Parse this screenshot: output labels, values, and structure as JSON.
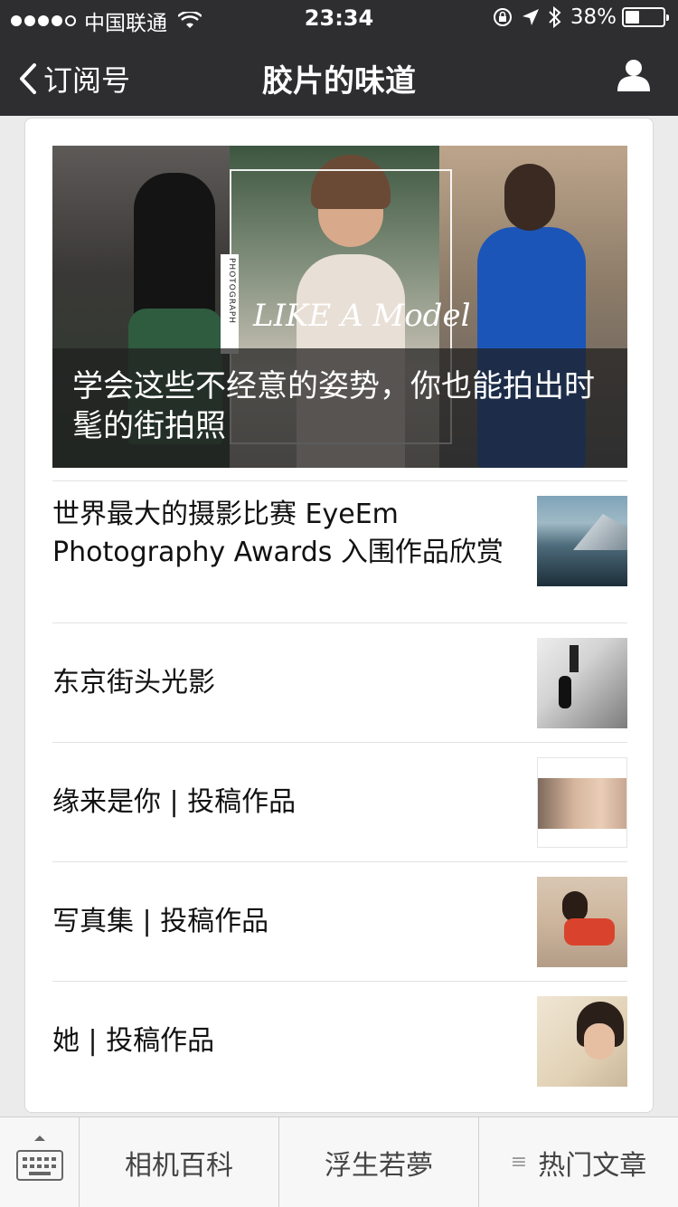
{
  "status_bar": {
    "carrier": "中国联通",
    "time": "23:34",
    "battery_percent": "38%",
    "battery_level": 0.38
  },
  "nav": {
    "back_label": "订阅号",
    "title": "胶片的味道",
    "back_icon": "chevron-left-icon",
    "profile_icon": "user-icon"
  },
  "hero": {
    "overlay_text": "LIKE A Model",
    "side_text": "PHOTOGRAPH",
    "caption": "学会这些不经意的姿势，你也能拍出时髦的街拍照"
  },
  "articles": [
    {
      "title": "世界最大的摄影比赛 EyeEm Photography Awards 入围作品欣赏"
    },
    {
      "title": "东京街头光影"
    },
    {
      "title": "缘来是你 | 投稿作品"
    },
    {
      "title": "写真集 | 投稿作品"
    },
    {
      "title": "她 | 投稿作品"
    }
  ],
  "tabbar": {
    "keyboard_icon": "keyboard-icon",
    "tabs": [
      {
        "label": "相机百科"
      },
      {
        "label": "浮生若夢"
      },
      {
        "label": "热门文章",
        "icon": "menu-icon"
      }
    ]
  },
  "colors": {
    "nav_bg": "#2e2e30",
    "page_bg": "#ebebeb"
  }
}
